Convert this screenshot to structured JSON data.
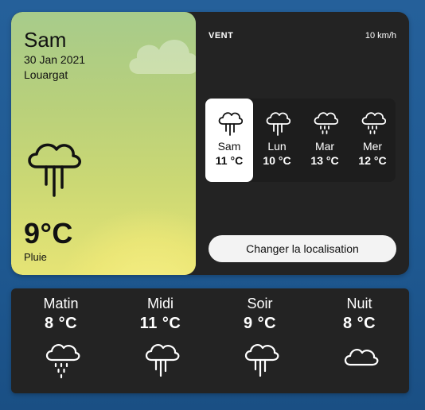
{
  "today": {
    "day": "Sam",
    "date": "30 Jan 2021",
    "location": "Louargat",
    "temperature": "9°C",
    "condition": "Pluie",
    "icon": "rain-cloud-icon"
  },
  "wind": {
    "label": "VENT",
    "value": "10 km/h"
  },
  "forecast": [
    {
      "day": "Sam",
      "temp": "11 °C",
      "icon": "rain-cloud-icon",
      "selected": true
    },
    {
      "day": "Lun",
      "temp": "10 °C",
      "icon": "rain-cloud-icon"
    },
    {
      "day": "Mar",
      "temp": "13 °C",
      "icon": "showers-cloud-icon"
    },
    {
      "day": "Mer",
      "temp": "12 °C",
      "icon": "showers-cloud-icon"
    }
  ],
  "change_location_label": "Changer la localisation",
  "periods": [
    {
      "name": "Matin",
      "temp": "8 °C",
      "icon": "showers-cloud-icon"
    },
    {
      "name": "Midi",
      "temp": "11 °C",
      "icon": "rain-cloud-icon"
    },
    {
      "name": "Soir",
      "temp": "9 °C",
      "icon": "rain-cloud-icon"
    },
    {
      "name": "Nuit",
      "temp": "8 °C",
      "icon": "cloud-icon"
    }
  ],
  "colors": {
    "background": "#1f5a93",
    "card": "#232323",
    "today_gradient_top": "#a7cb8b",
    "today_gradient_bottom": "#e6e475"
  }
}
